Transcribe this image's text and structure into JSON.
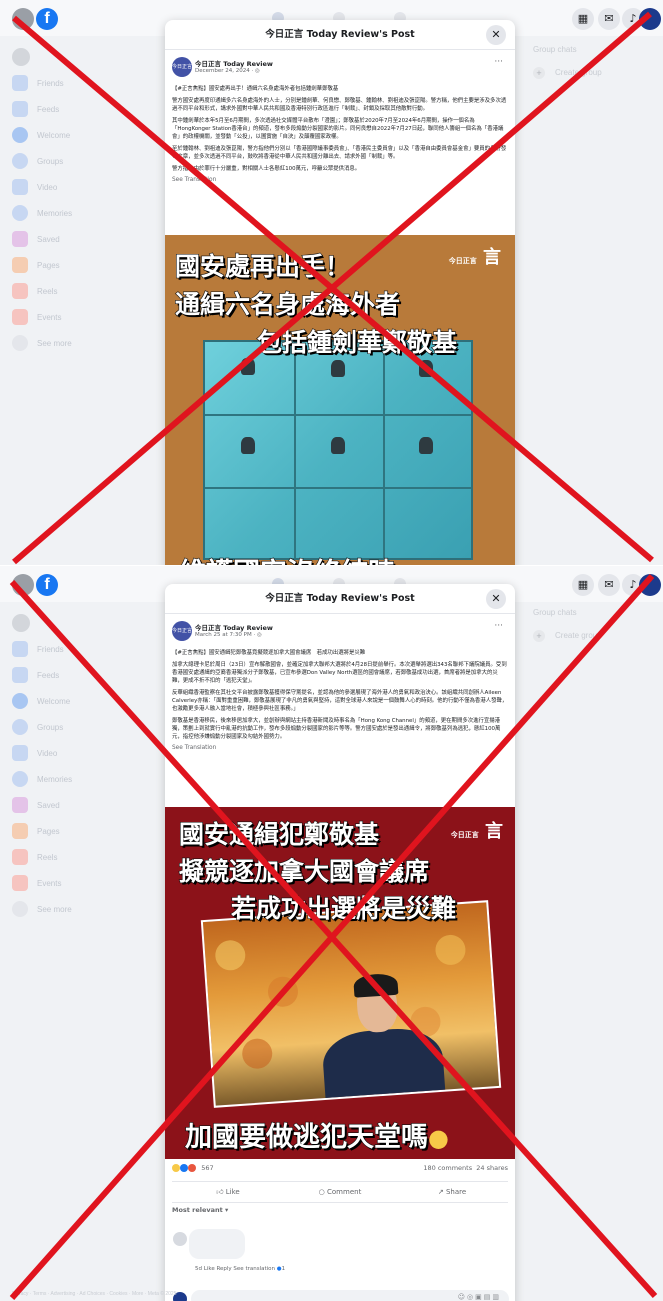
{
  "colors": {
    "fb_blue": "#1877f2",
    "cross_red": "#e0141e",
    "image2_bg": "#8c1219",
    "image1_bg": "#b87a3a"
  },
  "nav": {
    "facebook_logo": "f",
    "icons": [
      "home-icon",
      "video-icon",
      "marketplace-icon"
    ],
    "right_icons": [
      "menu-grid-icon",
      "messenger-icon",
      "bell-icon"
    ]
  },
  "sidebar": {
    "items": [
      {
        "label": "Friends",
        "icon": "friends-icon",
        "color": "#b9cdf0"
      },
      {
        "label": "Feeds",
        "icon": "feeds-icon",
        "color": "#b9cdf0"
      },
      {
        "label": "Welcome",
        "icon": "facebook-icon",
        "color": "#a8c6f2"
      },
      {
        "label": "Groups",
        "icon": "groups-icon",
        "color": "#b9cdf0"
      },
      {
        "label": "Video",
        "icon": "video-icon",
        "color": "#b9cdf0"
      },
      {
        "label": "Memories",
        "icon": "memories-icon",
        "color": "#b9cdf0"
      },
      {
        "label": "Saved",
        "icon": "saved-icon",
        "color": "#e2b9e6"
      },
      {
        "label": "Pages",
        "icon": "pages-icon",
        "color": "#f3c4a6"
      },
      {
        "label": "Reels",
        "icon": "reels-icon",
        "color": "#f5b9b5"
      },
      {
        "label": "Events",
        "icon": "events-icon",
        "color": "#f5b9b5"
      },
      {
        "label": "See more",
        "icon": "chevron-down-icon",
        "color": "#dcdfe3"
      }
    ]
  },
  "right_column": {
    "heading": "Group chats",
    "create": "Create group"
  },
  "post1": {
    "modal_title": "今日正言 Today Review's Post",
    "page_name": "今日正言 Today Review",
    "date": "December 24, 2024 · ",
    "paragraphs": [
      "【#正言焦點】國安處再出手！通緝六名身處海外者包括鍾劍華鄭敬基",
      "警方國安處再度印通緝多六名身處海外的人士，分別是鍾劍華、何良懋、鄭敬基、鍾翰林、劉祖迪及張崑陽。警方稱，他們主要是涉及多次透過不同平台和形式，講求外國對中華人民共和國及香港特別行政區進行「制裁」、封鎖及採取其他敵對行動。",
      "其中鍾劍華於本年5月至6月期間，多次透過社交媒體平台散布「澄園」；鄭敬基於2020年7月至2024年6月期間，操作一個名為「HongKonger Station香港台」的頻道，發布多段煽動分裂國家的影片。同何良懋自2022年7月27日起，聯同他人籌組一個名為「香港議會」的政權機關，並發動「公投」，以圖實施「自決」及顛覆國家政權。",
      "至於鍾翰林、劉祖迪及張崑陽，警方指他們分別以「香港國際議事委員會」、「香港民主委員會」以及「香港自由委員會基金會」要員的身份發布文章，並多次透過不同平台，鼓吹將香港從中華人民共和國分離出去、請求外國「制裁」等。",
      "警方指，由於罪行十分嚴重，對相關人士各懸紅100萬元，呼籲公眾提供消息。"
    ],
    "see_translation": "See Translation",
    "image_caption_line1": "國安處再出手！",
    "image_caption_line2": "通緝六名身處海外者",
    "image_caption_line3": "包括鍾劍華鄭敬基",
    "image_caption_bottom": "維護國安沒終結時",
    "logo_text": "今日正言"
  },
  "post2": {
    "modal_title": "今日正言 Today Review's Post",
    "page_name": "今日正言 Today Review",
    "date": "March 25 at 7:30 PM · ",
    "paragraphs": [
      "【#正言焦點】國安通緝犯鄭敬基竟擬競逐加拿大國會議席　若成功出選將是災難",
      "加拿大總理卡尼於周日（23日）宣布解散國會，並確定加拿大聯邦大選將於4月28日提前舉行。本次選舉將選出343名聯邦下議院議員。受到香港國安處通緝的亞裔香港獨派分子鄭敬基，已宣布參選Don Valley North選區的國會議席，若鄭敬基成功出選，首席者將是加拿大的災難，更成不折不扣的「逃犯天堂」。",
      "反華組織香港監察在其社交平台披露鄭敬基獲得保守黨提名，並認為他的參選展現了海外港人的勇氣和政治決心。該組織共同創辦人Aileen Calverley亦稱：「面對重重困難，鄭敬基展現了非凡的勇氣與堅持，這對全球港人來說是一個鼓舞人心的時刻。他的行動不僅為香港人發聲，也激勵更多港人融入當地社會，積極參與社區事務。」",
      "鄭敬基是香港移民，後來移居加拿大，並創辦與網站主持香港新聞及時事名為「Hong Kong Channel」的頻道，更在期間多次進行宣揚港獨，策劃上到就實行中亂港的抗動工作，發布多段煽動分裂國家的影片等等。警方國安處於是發出通緝令，將鄭敬基列為逃犯，懸紅100萬元，指控他涉嫌煽動分裂國家及勾結外國勢力。"
    ],
    "see_translation": "See Translation",
    "image_caption_line1": "國安通緝犯鄭敬基",
    "image_caption_line2": "擬競逐加拿大國會議席",
    "image_caption_line3": "若成功出選將是災難",
    "image_caption_bottom": "加國要做逃犯天堂嗎",
    "logo_text": "今日正言",
    "reaction_count": "567",
    "comments_count": "180 comments",
    "shares_count": "24 shares",
    "like_label": "Like",
    "comment_label": "Comment",
    "share_label": "Share",
    "most_relevant": "Most relevant ▾",
    "comment_meta": "5d   Like   Reply   See translation",
    "comment_reactions": "1"
  },
  "footer": "Privacy · Terms · Advertising · Ad Choices · Cookies · More · Meta © 2025"
}
